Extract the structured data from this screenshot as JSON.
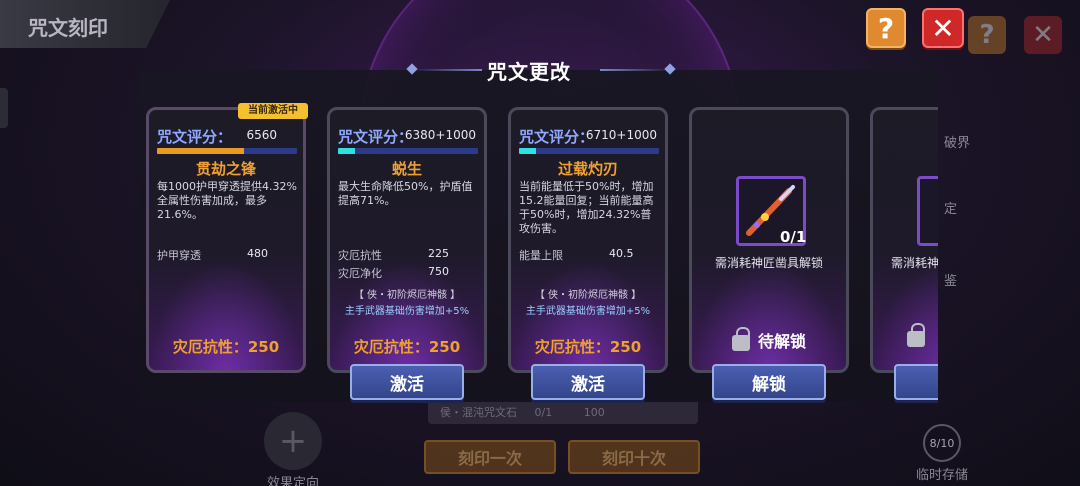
{
  "background": {
    "page_title": "咒文刻印",
    "help_label": "?",
    "close_label": "✕",
    "right_items": [
      "破界",
      "定",
      "鉴"
    ],
    "effect_label": "效果定向",
    "strip_text": "侯・混沌咒文石",
    "strip_count": "0/1",
    "strip_cost": "100",
    "engrave_once": "刻印一次",
    "engrave_ten": "刻印十次",
    "storage_count": "8/10",
    "storage_label": "临时存储"
  },
  "modal": {
    "title": "咒文更改",
    "help_label": "?",
    "close_label": "✕",
    "active_tag": "当前激活中",
    "cards": [
      {
        "score_label": "咒文评分：",
        "score_value": "6560",
        "score_bar": 0.62,
        "name": "贯劫之锋",
        "desc": "每1000护甲穿透提供4.32%全属性伤害加成，最多21.6%。",
        "stats": [
          {
            "label": "护甲穿透",
            "value": "480"
          }
        ],
        "resist": "灾厄抗性：250"
      },
      {
        "score_label": "咒文评分：",
        "score_value": "6380+1000",
        "score_bar": 0.0,
        "score_bonus_bar": 0.12,
        "name": "蜕生",
        "desc": "最大生命降低50%，护盾值提高71%。",
        "stats": [
          {
            "label": "灾厄抗性",
            "value": "225"
          },
          {
            "label": "灾厄净化",
            "value": "750"
          }
        ],
        "set_name": "【 侠・初阶烬厄神骸 】",
        "set_bonus": "主手武器基础伤害增加+5%",
        "resist": "灾厄抗性：250",
        "button": "激活"
      },
      {
        "score_label": "咒文评分：",
        "score_value": "6710+1000",
        "score_bar": 0.0,
        "score_bonus_bar": 0.12,
        "name": "过载灼刃",
        "desc": "当前能量低于50%时，增加15.2能量回复；当前能量高于50%时，增加24.32%普攻伤害。",
        "stats": [
          {
            "label": "能量上限",
            "value": "40.5"
          }
        ],
        "set_name": "【 侠・初阶烬厄神骸 】",
        "set_bonus": "主手武器基础伤害增加+5%",
        "resist": "灾厄抗性：250",
        "button": "激活"
      },
      {
        "item_count": "0/1",
        "need": "需消耗神匠凿具解锁",
        "lock_label": "待解锁",
        "button": "解锁"
      },
      {
        "need": "需消耗神"
      }
    ]
  },
  "colors": {
    "score_label": "#8fa8ff",
    "name_orange": "#f0a030",
    "button_blue": "#4b5fb2",
    "help_orange": "#e08a30",
    "close_red": "#d02828",
    "active_tag": "#f4c030"
  }
}
